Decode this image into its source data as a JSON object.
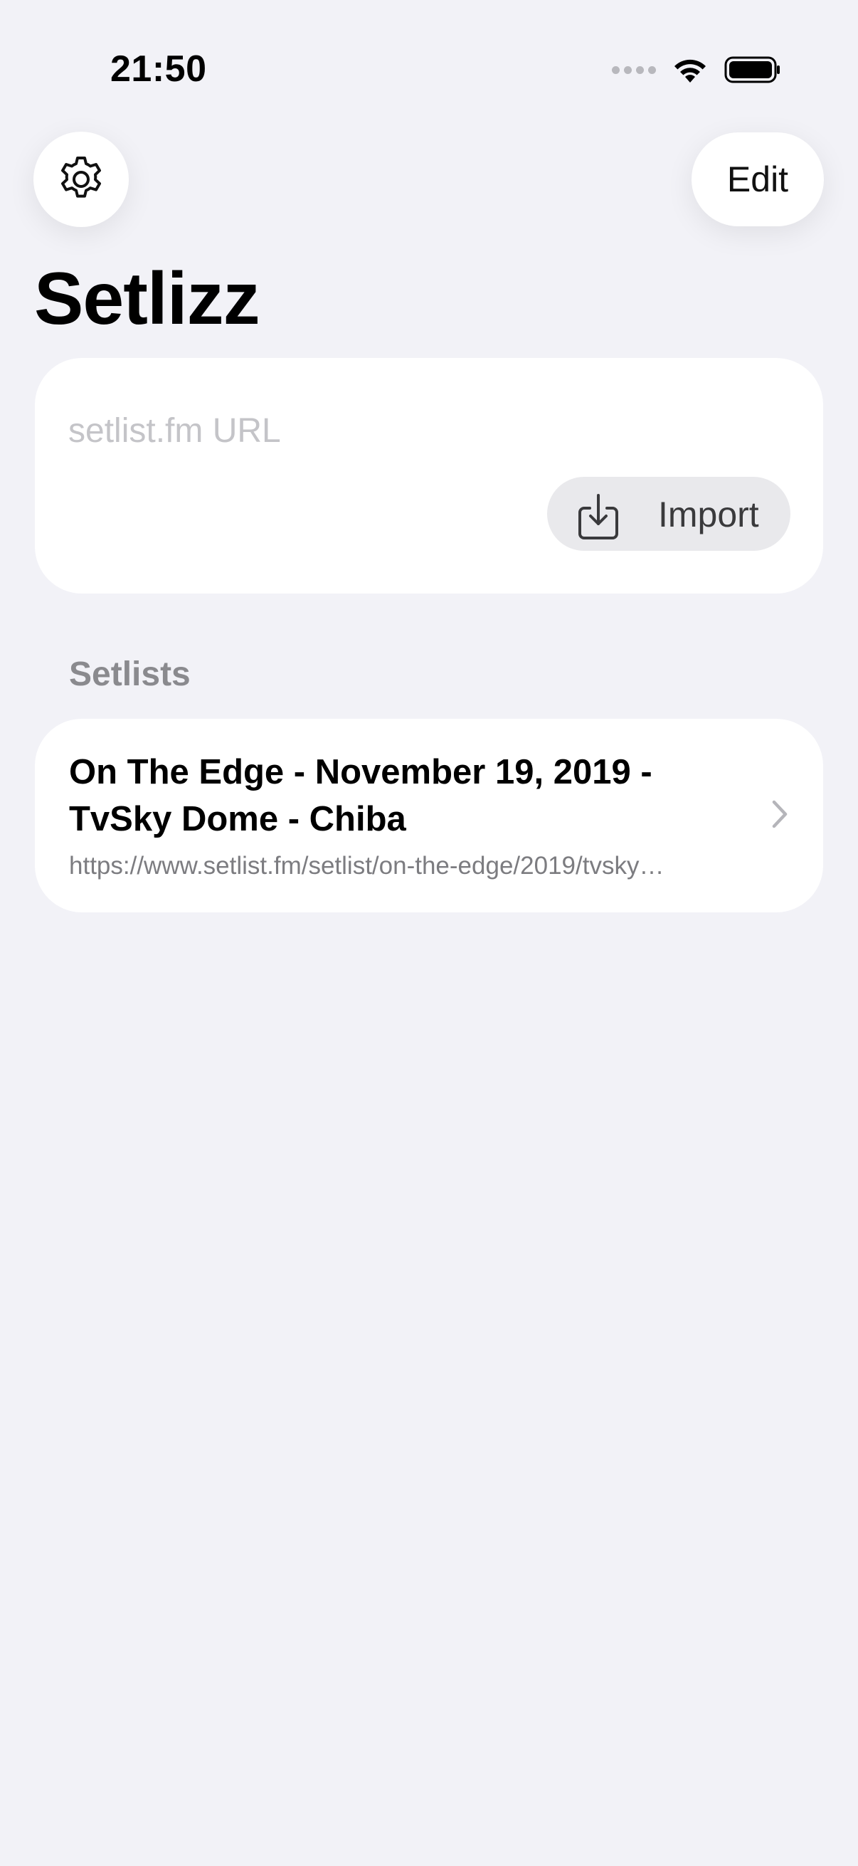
{
  "status_bar": {
    "time": "21:50"
  },
  "toolbar": {
    "settings_icon": "gear-icon",
    "edit_label": "Edit"
  },
  "page": {
    "title": "Setlizz"
  },
  "import_card": {
    "url_placeholder": "setlist.fm URL",
    "url_value": "",
    "import_icon": "download-tray-icon",
    "import_label": "Import"
  },
  "setlists": {
    "header": "Setlists",
    "items": [
      {
        "title": "On The Edge - November 19, 2019 - TvSky Dome - Chiba",
        "url": "https://www.setlist.fm/setlist/on-the-edge/2019/tvsky…"
      }
    ]
  },
  "colors": {
    "background": "#f2f2f7",
    "card": "#ffffff",
    "secondary_text": "#8a8a8e",
    "button_fill": "#e9e9ec"
  }
}
